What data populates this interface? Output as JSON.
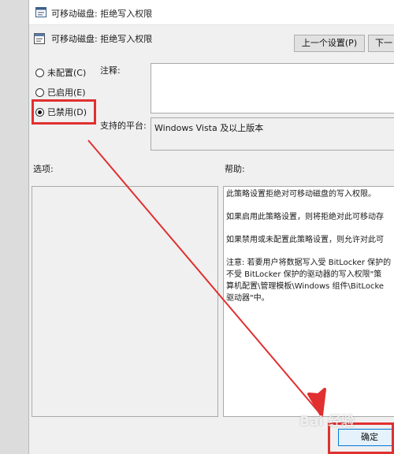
{
  "window": {
    "title": "可移动磁盘: 拒绝写入权限",
    "header_title": "可移动磁盘: 拒绝写入权限"
  },
  "nav": {
    "prev_label": "上一个设置(P)",
    "next_label": "下一"
  },
  "state": {
    "options": [
      {
        "label": "未配置(C)",
        "checked": false
      },
      {
        "label": "已启用(E)",
        "checked": false
      },
      {
        "label": "已禁用(D)",
        "checked": true
      }
    ]
  },
  "comment": {
    "label": "注释:",
    "value": ""
  },
  "platform": {
    "label": "支持的平台:",
    "value": "Windows Vista 及以上版本"
  },
  "options_panel": {
    "label": "选项:"
  },
  "help": {
    "label": "帮助:",
    "p1": "此策略设置拒绝对可移动磁盘的写入权限。",
    "p2": "如果启用此策略设置，则将拒绝对此可移动存",
    "p3": "如果禁用或未配置此策略设置，则允许对此可",
    "p4_l1": "注意: 若要用户将数据写入受 BitLocker 保护的",
    "p4_l2": "不受 BitLocker 保护的驱动器的写入权限\"策",
    "p4_l3": "算机配置\\管理模板\\Windows 组件\\BitLocke",
    "p4_l4": "驱动器\"中。"
  },
  "footer": {
    "ok_label": "确定"
  },
  "watermark": {
    "text": "Bai 经验"
  },
  "colors": {
    "annotation": "#e03030",
    "dialog_bg": "#f0f0f0"
  }
}
